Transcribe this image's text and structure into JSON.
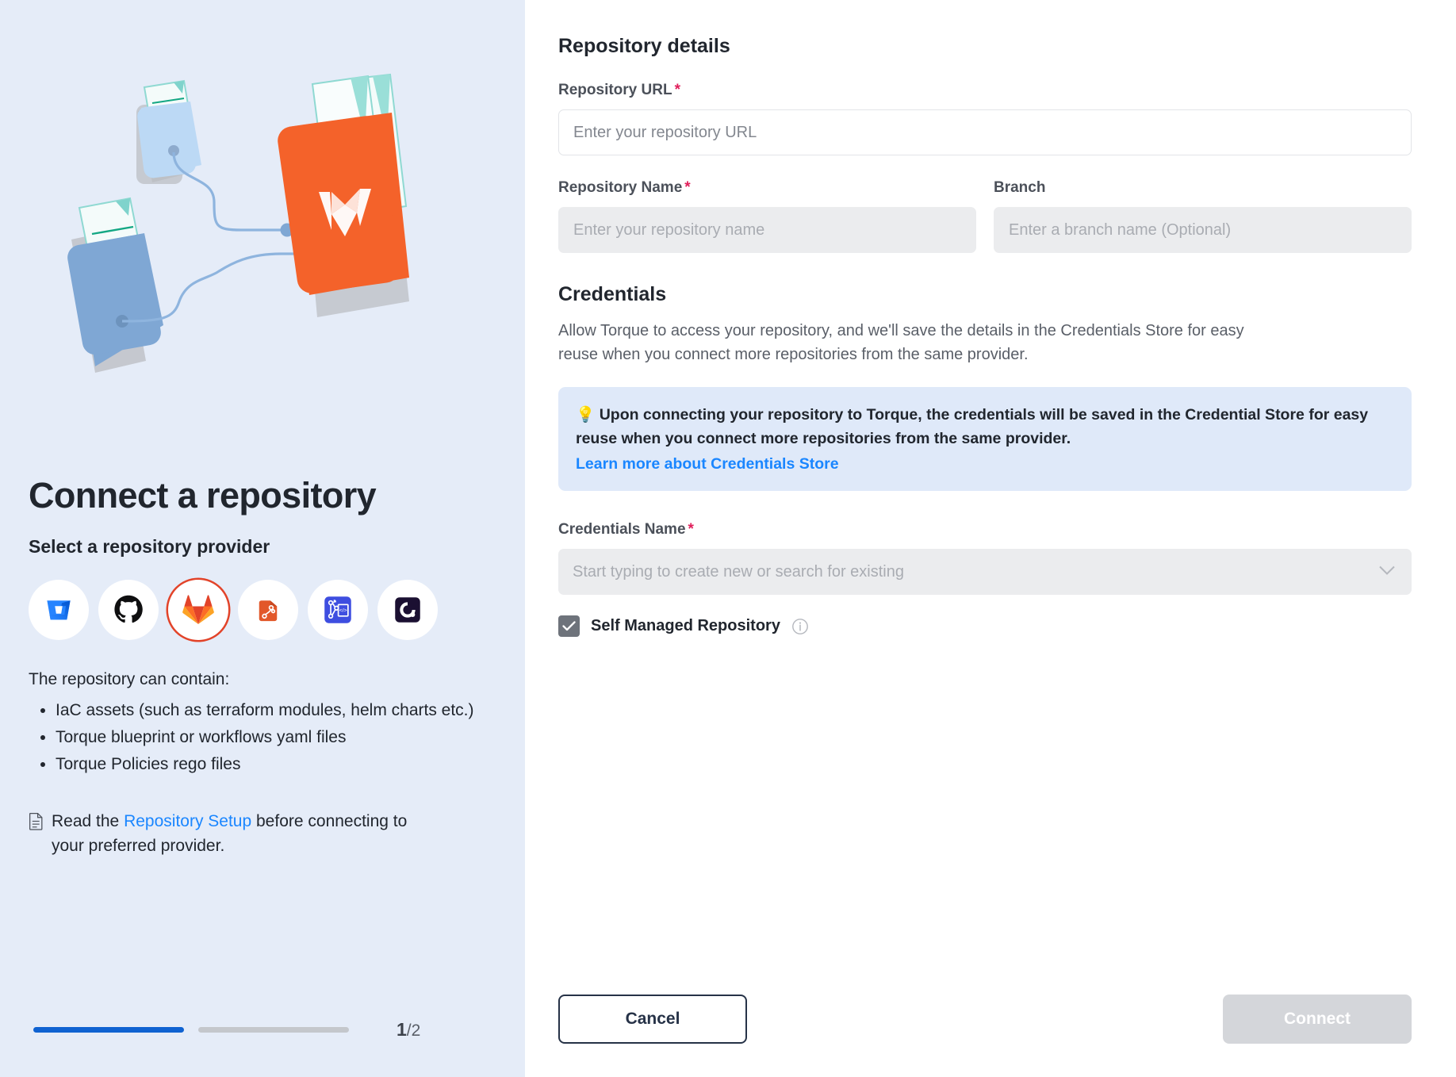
{
  "left": {
    "illustration_name": "connect-repository-illustration",
    "title": "Connect a repository",
    "subtitle": "Select a repository provider",
    "providers": [
      {
        "id": "bitbucket",
        "label": "Bitbucket",
        "selected": false
      },
      {
        "id": "github",
        "label": "GitHub",
        "selected": false
      },
      {
        "id": "gitlab",
        "label": "GitLab",
        "selected": true
      },
      {
        "id": "codecommit",
        "label": "AWS CodeCommit",
        "selected": false
      },
      {
        "id": "azure-devops",
        "label": "Azure DevOps",
        "selected": false
      },
      {
        "id": "torque",
        "label": "Torque",
        "selected": false
      }
    ],
    "contains_label": "The repository can contain:",
    "contains_items": [
      "IaC assets (such as terraform modules, helm charts etc.)",
      "Torque blueprint or workflows yaml files",
      "Torque Policies rego files"
    ],
    "read_prefix": "Read the ",
    "read_link": "Repository Setup",
    "read_suffix": " before connecting to your preferred provider.",
    "progress": {
      "current": "1",
      "separator": "/",
      "total": "2",
      "steps_done": 1,
      "steps_total": 2
    }
  },
  "right": {
    "section_title": "Repository details",
    "repo_url": {
      "label": "Repository URL",
      "required": "*",
      "placeholder": "Enter your repository URL",
      "value": ""
    },
    "repo_name": {
      "label": "Repository Name",
      "required": "*",
      "placeholder": "Enter your repository name",
      "value": ""
    },
    "branch": {
      "label": "Branch",
      "placeholder": "Enter a branch name (Optional)",
      "value": ""
    },
    "credentials": {
      "title": "Credentials",
      "description": "Allow Torque to access your repository, and we'll save the details in the Credentials Store for easy reuse when you connect more repositories from the same provider.",
      "notice_emoji": "💡",
      "notice_text": "Upon connecting your repository to Torque, the credentials will be saved in the Credential Store for easy reuse when you connect more repositories from the same provider.",
      "notice_link": "Learn more about Credentials Store",
      "name_label": "Credentials Name",
      "name_required": "*",
      "name_placeholder": "Start typing to create new or search for existing",
      "name_value": ""
    },
    "self_managed": {
      "label": "Self Managed Repository",
      "checked": true
    },
    "cancel_label": "Cancel",
    "connect_label": "Connect"
  },
  "colors": {
    "panel_bg": "#e5ecf8",
    "accent_blue": "#0f62d1",
    "link_blue": "#1a86ff",
    "required_red": "#e01e5a",
    "gitlab_orange": "#e24329",
    "notice_bg": "#dfe9f9",
    "disabled_gray": "#ebecee"
  }
}
